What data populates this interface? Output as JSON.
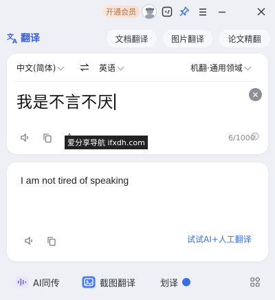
{
  "titlebar": {
    "vip_label": "开通会员",
    "icons": [
      "avatar-icon",
      "game-icon",
      "pin-icon",
      "menu-icon",
      "minimize-icon",
      "close-icon"
    ]
  },
  "toolbar": {
    "app_title": "翻译",
    "tabs": [
      "文档翻译",
      "图片翻译",
      "论文精翻"
    ]
  },
  "source": {
    "from_lang": "中文(简体)",
    "to_lang": "英语",
    "engine": "机翻·通用领域",
    "text": "我是不言不厌",
    "counter": "6/1000"
  },
  "watermark": "爱分享导航 ifxdh.com",
  "target": {
    "text": "I am not tired of speaking",
    "ai_link": "试试AI+人工翻译"
  },
  "bottombar": {
    "items": [
      "AI同传",
      "截图翻译",
      "划译"
    ],
    "toggle_on": true
  },
  "colors": {
    "accent": "#3a6ee0",
    "background": "#eef0f6",
    "vip_text": "#b9714e"
  }
}
